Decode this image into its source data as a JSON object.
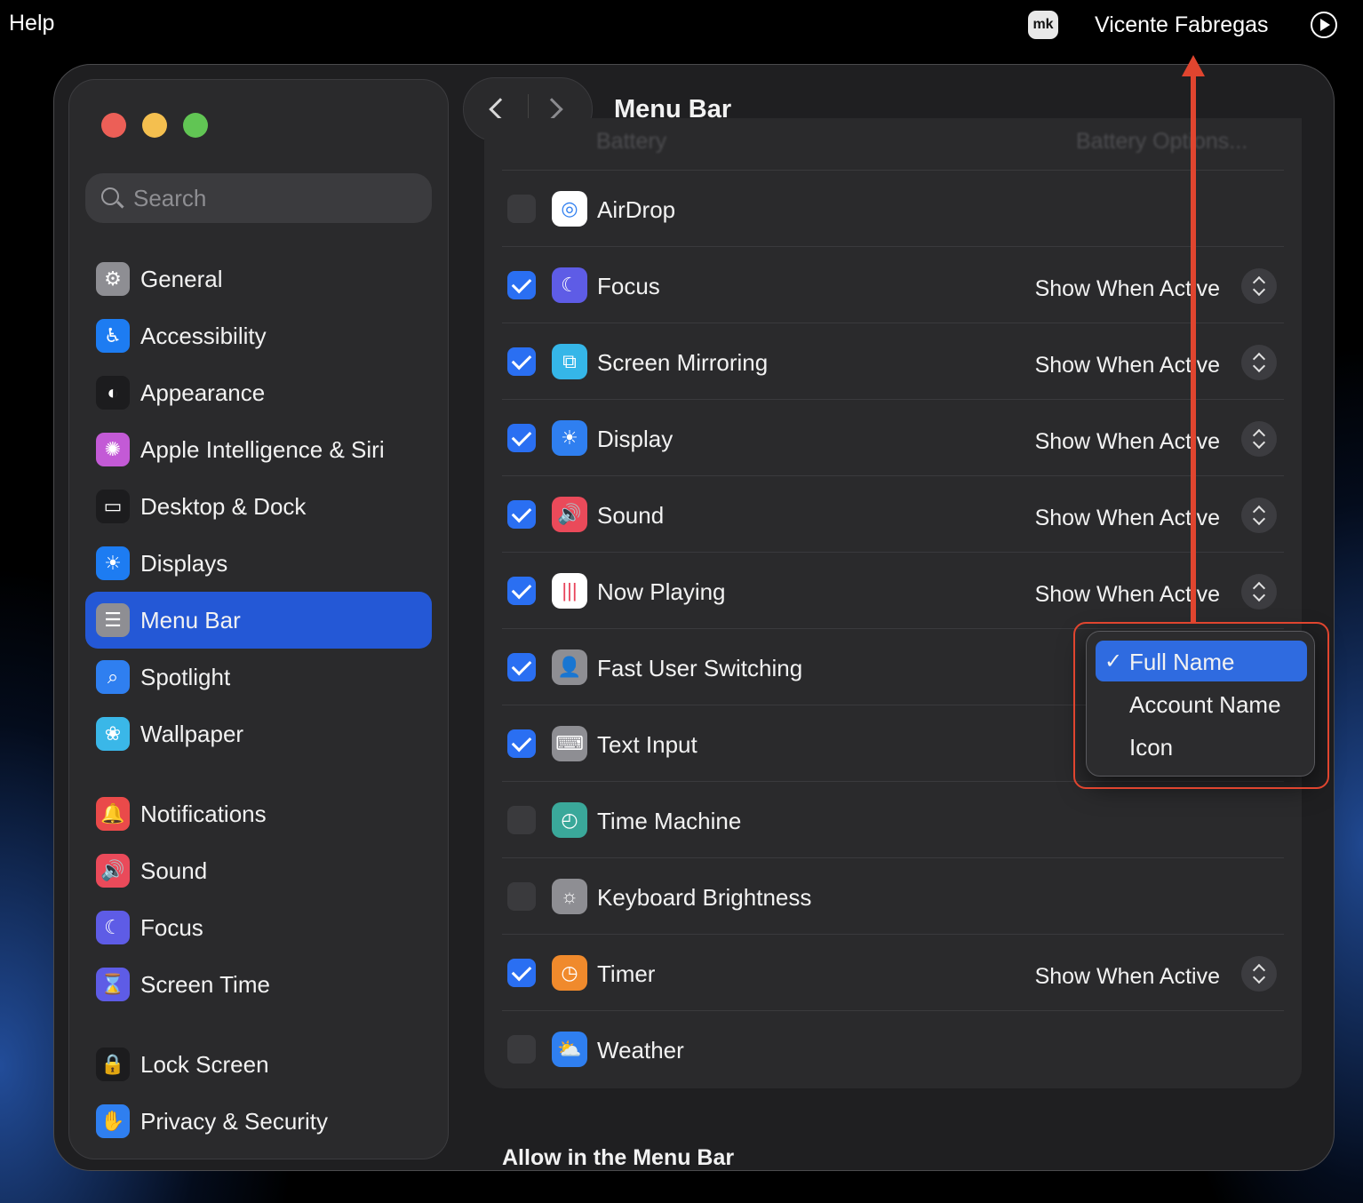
{
  "system_menu_bar": {
    "help": "Help",
    "app_badge": "mk",
    "user_name": "Vicente Fabregas",
    "play_icon": "play-circle-icon"
  },
  "window": {
    "title": "Menu Bar",
    "search_placeholder": "Search",
    "sidebar": {
      "items": [
        {
          "label": "General",
          "icon": "gear-icon",
          "color": "#8e8e93",
          "glyph": "⚙"
        },
        {
          "label": "Accessibility",
          "icon": "accessibility-icon",
          "color": "#1d7cf2",
          "glyph": "♿"
        },
        {
          "label": "Appearance",
          "icon": "appearance-icon",
          "color": "#1c1c1e",
          "glyph": "◐"
        },
        {
          "label": "Apple Intelligence & Siri",
          "icon": "siri-icon",
          "color": "#c35ad6",
          "glyph": "✺"
        },
        {
          "label": "Desktop & Dock",
          "icon": "dock-icon",
          "color": "#1c1c1e",
          "glyph": "▭"
        },
        {
          "label": "Displays",
          "icon": "sun-icon",
          "color": "#1d7cf2",
          "glyph": "☀"
        },
        {
          "label": "Menu Bar",
          "icon": "menu-bar-icon",
          "color": "#8e8e93",
          "glyph": "☰",
          "active": true
        },
        {
          "label": "Spotlight",
          "icon": "magnifier-icon",
          "color": "#2f7ff0",
          "glyph": "⌕"
        },
        {
          "label": "Wallpaper",
          "icon": "flower-icon",
          "color": "#3ab7e8",
          "glyph": "❀"
        },
        {
          "label": "Notifications",
          "icon": "bell-icon",
          "color": "#ea4a4a",
          "glyph": "🔔"
        },
        {
          "label": "Sound",
          "icon": "speaker-icon",
          "color": "#ea4a5a",
          "glyph": "🔊"
        },
        {
          "label": "Focus",
          "icon": "moon-icon",
          "color": "#5e5ce6",
          "glyph": "☾"
        },
        {
          "label": "Screen Time",
          "icon": "hourglass-icon",
          "color": "#5e5ce6",
          "glyph": "⌛"
        },
        {
          "label": "Lock Screen",
          "icon": "lock-icon",
          "color": "#1c1c1e",
          "glyph": "🔒"
        },
        {
          "label": "Privacy & Security",
          "icon": "hand-icon",
          "color": "#2f7ff0",
          "glyph": "✋"
        }
      ]
    },
    "menu_items": {
      "ghost_top": {
        "label": "Battery",
        "button": "Battery Options..."
      },
      "rows": [
        {
          "label": "AirDrop",
          "checked": false,
          "icon": "airdrop-icon",
          "color": "#ffffff",
          "glyph": "◎",
          "glyph_color": "#2f7ff0",
          "value": ""
        },
        {
          "label": "Focus",
          "checked": true,
          "icon": "moon-icon",
          "color": "#5e5ce6",
          "glyph": "☾",
          "glyph_color": "#ffffff",
          "value": "Show When Active"
        },
        {
          "label": "Screen Mirroring",
          "checked": true,
          "icon": "screen-mirroring-icon",
          "color": "#35b6e8",
          "glyph": "⧉",
          "glyph_color": "#ffffff",
          "value": "Show When Active"
        },
        {
          "label": "Display",
          "checked": true,
          "icon": "sun-icon",
          "color": "#2f7ff0",
          "glyph": "☀",
          "glyph_color": "#ffffff",
          "value": "Show When Active"
        },
        {
          "label": "Sound",
          "checked": true,
          "icon": "speaker-icon",
          "color": "#ea4a5a",
          "glyph": "🔊",
          "glyph_color": "#ffffff",
          "value": "Show When Active"
        },
        {
          "label": "Now Playing",
          "checked": true,
          "icon": "waveform-icon",
          "color": "#ffffff",
          "glyph": "|||",
          "glyph_color": "#e8435a",
          "value": "Show When Active"
        },
        {
          "label": "Fast User Switching",
          "checked": true,
          "icon": "user-circle-icon",
          "color": "#8e8e93",
          "glyph": "👤",
          "glyph_color": "#ffffff",
          "value": ""
        },
        {
          "label": "Text Input",
          "checked": true,
          "icon": "keyboard-icon",
          "color": "#8e8e93",
          "glyph": "⌨",
          "glyph_color": "#ffffff",
          "value": ""
        },
        {
          "label": "Time Machine",
          "checked": false,
          "icon": "time-machine-icon",
          "color": "#3aa89a",
          "glyph": "◴",
          "glyph_color": "#ffffff",
          "value": ""
        },
        {
          "label": "Keyboard Brightness",
          "checked": false,
          "icon": "keyboard-brightness-icon",
          "color": "#8e8e93",
          "glyph": "☼",
          "glyph_color": "#ffffff",
          "value": ""
        },
        {
          "label": "Timer",
          "checked": true,
          "icon": "timer-icon",
          "color": "#f08a2c",
          "glyph": "◷",
          "glyph_color": "#ffffff",
          "value": "Show When Active"
        },
        {
          "label": "Weather",
          "checked": false,
          "icon": "weather-icon",
          "color": "#2f7ff0",
          "glyph": "⛅",
          "glyph_color": "#ffffff",
          "value": ""
        }
      ]
    },
    "dropdown": {
      "options": [
        {
          "label": "Full Name",
          "selected": true
        },
        {
          "label": "Account Name",
          "selected": false
        },
        {
          "label": "Icon",
          "selected": false
        }
      ],
      "check": "✓"
    },
    "section_title": "Allow in the Menu Bar"
  },
  "annotation_color": "#e0452f"
}
